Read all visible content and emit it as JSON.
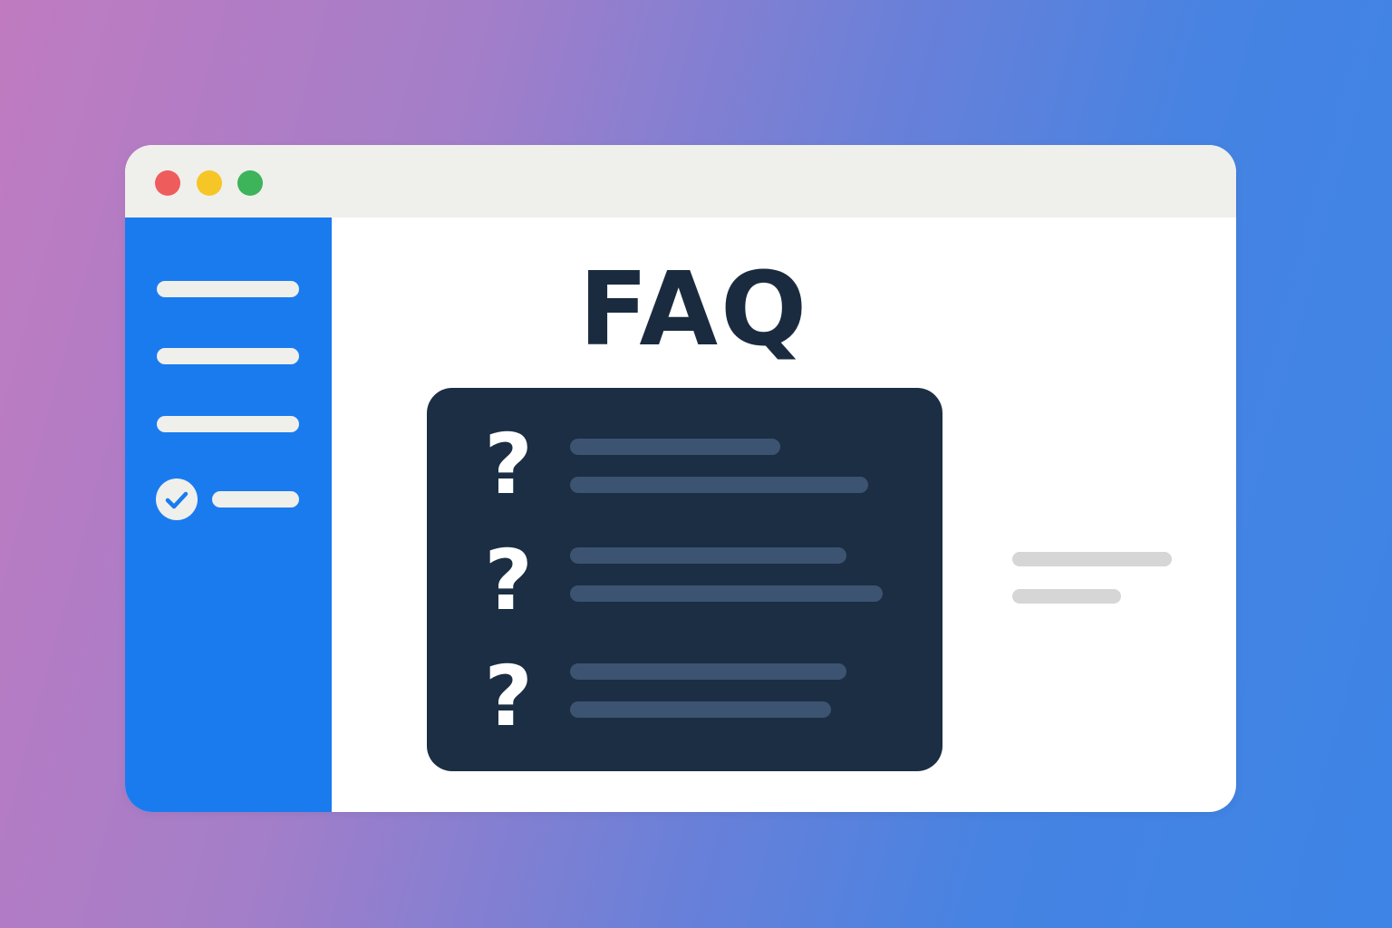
{
  "window": {
    "controls": [
      "close",
      "minimize",
      "maximize"
    ]
  },
  "sidebar": {
    "items": [
      {
        "name": "sidebar-item-1"
      },
      {
        "name": "sidebar-item-2"
      },
      {
        "name": "sidebar-item-3"
      },
      {
        "name": "sidebar-item-4",
        "icon": "check-circle-icon",
        "selected": true
      }
    ]
  },
  "main": {
    "title": "FAQ",
    "faq": [
      {
        "mark": "?"
      },
      {
        "mark": "?"
      },
      {
        "mark": "?"
      }
    ]
  },
  "colors": {
    "sidebar": "#1a7bef",
    "card": "#1b2e43",
    "title": "#1b2b3f"
  }
}
